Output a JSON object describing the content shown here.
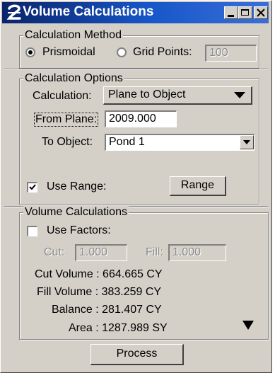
{
  "window": {
    "title": "Volume Calculations",
    "buttons": {
      "minimize": "minimize-icon",
      "maximize": "maximize-icon",
      "close": "close-icon"
    }
  },
  "calculation_method": {
    "legend": "Calculation Method",
    "prismoidal_label": "Prismoidal",
    "prismoidal_selected": true,
    "grid_points_label": "Grid Points:",
    "grid_points_selected": false,
    "grid_points_value": "100"
  },
  "calculation_options": {
    "legend": "Calculation Options",
    "calculation_label": "Calculation:",
    "calculation_value": "Plane to Object",
    "from_plane_label": "From Plane:",
    "from_plane_value": "2009.000",
    "to_object_label": "To Object:",
    "to_object_value": "Pond 1",
    "use_range_label": "Use Range:",
    "use_range_checked": true,
    "range_button": "Range"
  },
  "volume_calculations": {
    "legend": "Volume Calculations",
    "use_factors_label": "Use Factors:",
    "use_factors_checked": false,
    "cut_label": "Cut:",
    "cut_value": "1.000",
    "fill_label": "Fill:",
    "fill_value": "1.000",
    "cut_volume": "Cut Volume : 664.665 CY",
    "fill_volume": "Fill Volume : 383.259 CY",
    "balance": "Balance : 281.407 CY",
    "area": "Area : 1287.989 SY"
  },
  "process_button": "Process",
  "colors": {
    "title_bar": "#0a246a",
    "face": "#d4d0c8"
  }
}
